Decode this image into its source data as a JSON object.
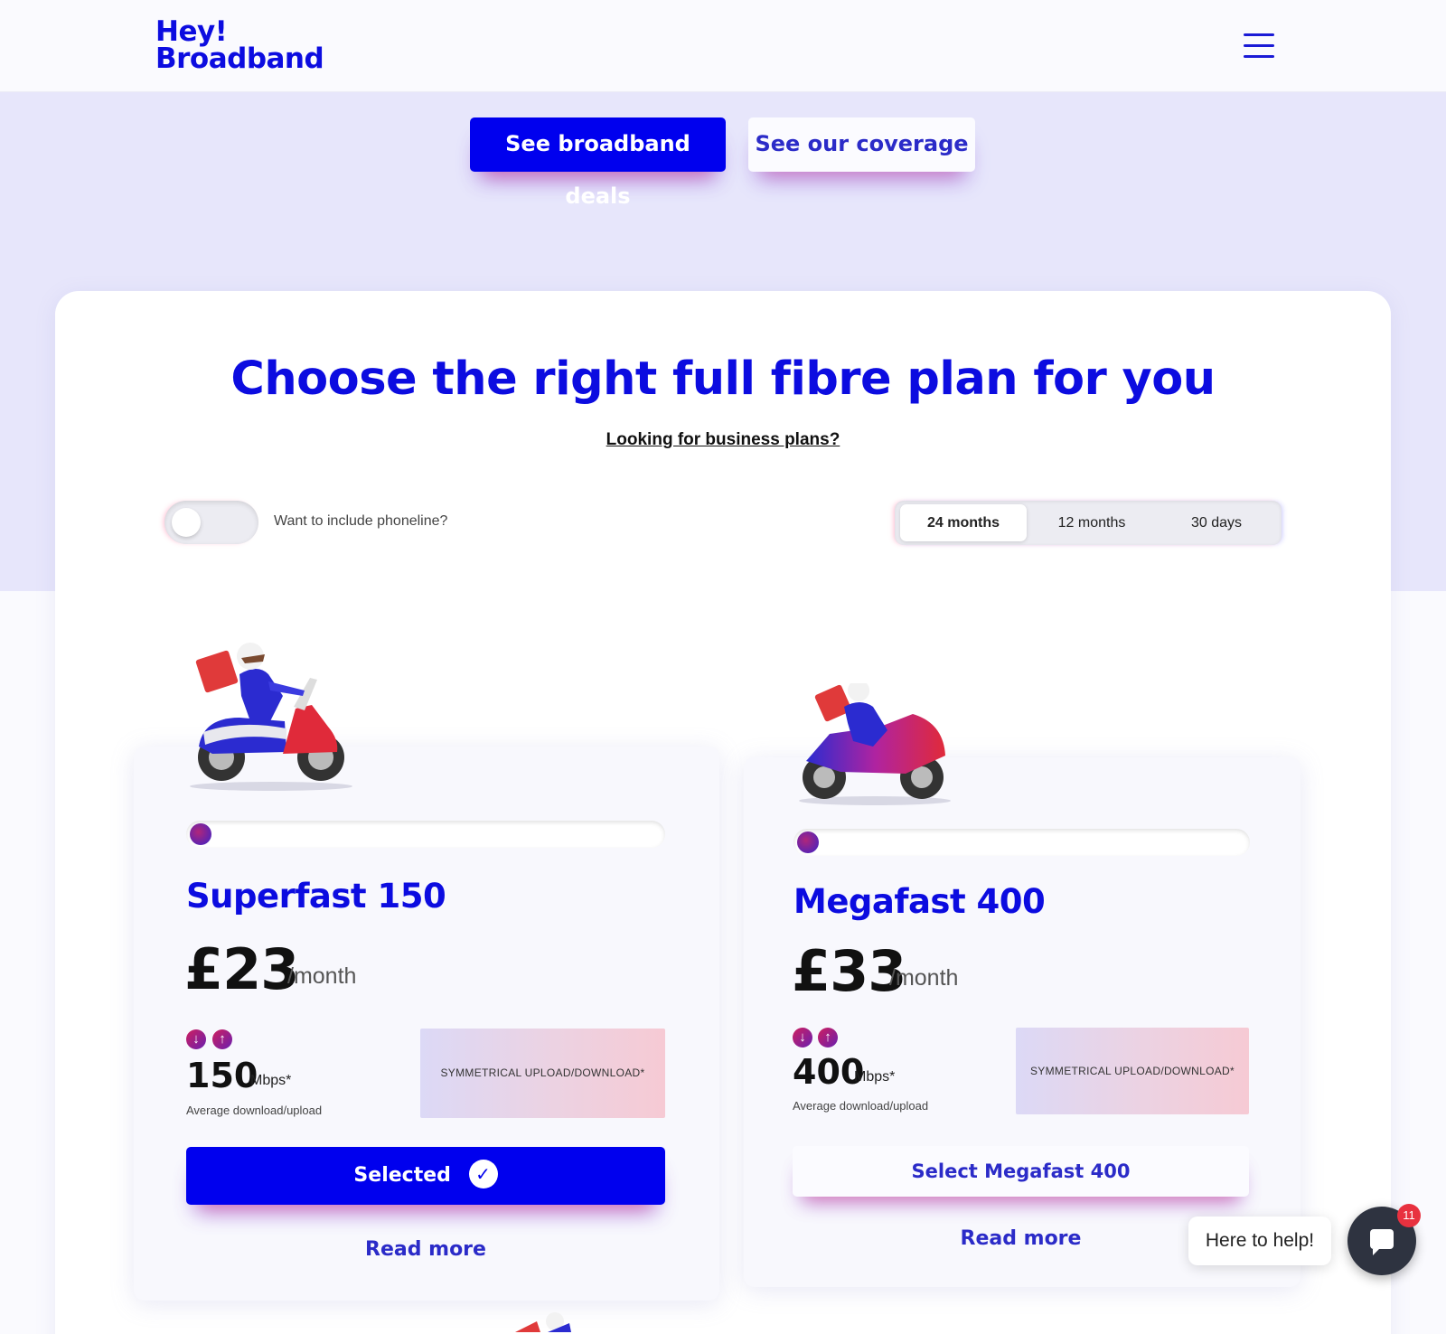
{
  "header": {
    "logo_line1": "Hey!",
    "logo_line2": "Broadband",
    "menu_icon": "hamburger-menu-icon"
  },
  "hero": {
    "primary_cta": "See broadband deals",
    "secondary_cta": "See our coverage"
  },
  "plans_section": {
    "title": "Choose the right full fibre plan for you",
    "business_link": "Looking for business plans?",
    "phoneline_label": "Want to include phoneline?",
    "phoneline_on": false,
    "terms": [
      "24 months",
      "12 months",
      "30 days"
    ],
    "active_term": "24 months"
  },
  "plans": [
    {
      "name": "Superfast 150",
      "price": "£23",
      "per": "/month",
      "speed": "150",
      "unit": "Mbps*",
      "caption": "Average download/upload",
      "badge": "SYMMETRICAL UPLOAD/DOWNLOAD*",
      "button": "Selected",
      "selected": true,
      "read_more": "Read more",
      "speed_level": 0.0,
      "illustration": "scooter-rider-icon"
    },
    {
      "name": "Megafast 400",
      "price": "£33",
      "per": "/month",
      "speed": "400",
      "unit": "Mbps*",
      "caption": "Average download/upload",
      "badge": "SYMMETRICAL UPLOAD/DOWNLOAD*",
      "button": "Select Megafast 400",
      "selected": false,
      "read_more": "Read more",
      "speed_level": 0.0,
      "illustration": "motorbike-rider-icon"
    }
  ],
  "chat": {
    "prompt": "Here to help!",
    "badge_count": "11"
  },
  "colors": {
    "brand_blue": "#0000ee",
    "link_blue": "#2b2bc8",
    "lavender": "#e7e6fb",
    "badge_red": "#e8313f"
  }
}
